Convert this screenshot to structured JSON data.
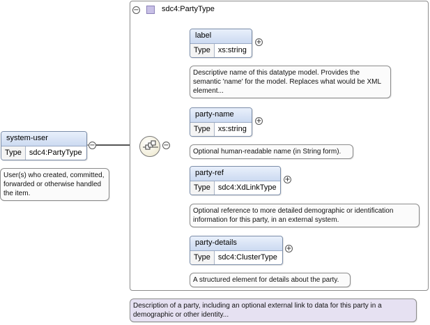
{
  "root": {
    "name": "system-user",
    "type_key": "Type",
    "type_value": "sdc4:PartyType",
    "annotation": "User(s) who created, committed, forwarded or otherwise handled the item."
  },
  "type_box": {
    "title": "sdc4:PartyType",
    "annotation": "Description of a party, including an optional external link to data for this party in a demographic or other identity..."
  },
  "toggles": {
    "collapse": "−",
    "expand": "+"
  },
  "icons": {
    "sequence": "sequence-compositor-icon",
    "type_square": "complex-type-icon"
  },
  "children": [
    {
      "name": "label",
      "type_key": "Type",
      "type_value": "xs:string",
      "annotation": "Descriptive name of this datatype model. Provides the semantic 'name' for the model. Replaces what would be XML element..."
    },
    {
      "name": "party-name",
      "type_key": "Type",
      "type_value": "xs:string",
      "annotation": "Optional human-readable name (in String form)."
    },
    {
      "name": "party-ref",
      "type_key": "Type",
      "type_value": "sdc4:XdLinkType",
      "annotation": "Optional reference to more detailed demographic or identification information for this party, in an external system."
    },
    {
      "name": "party-details",
      "type_key": "Type",
      "type_value": "sdc4:ClusterType",
      "annotation": "A structured element for details about the party."
    }
  ]
}
